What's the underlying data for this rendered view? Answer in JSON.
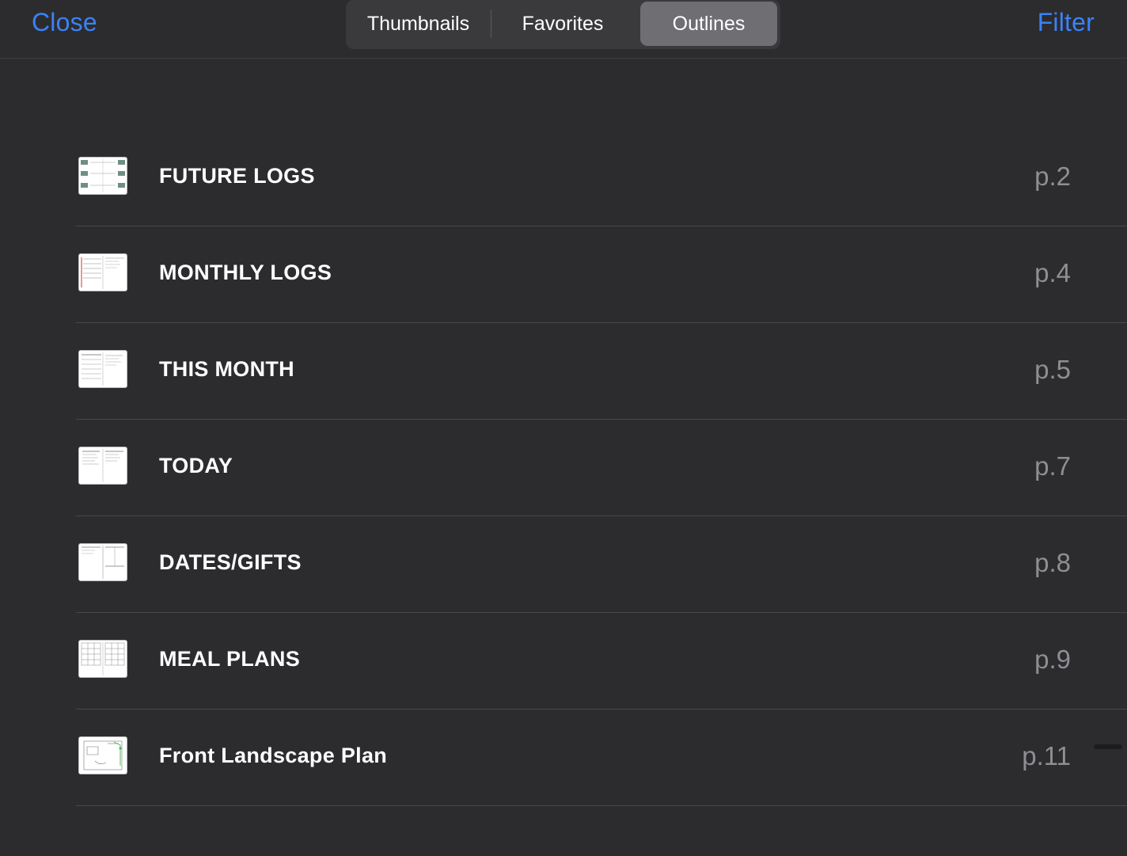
{
  "header": {
    "close_label": "Close",
    "filter_label": "Filter",
    "tabs": [
      {
        "label": "Thumbnails",
        "selected": false
      },
      {
        "label": "Favorites",
        "selected": false
      },
      {
        "label": "Outlines",
        "selected": true
      }
    ]
  },
  "colors": {
    "accent": "#3b82f6",
    "background": "#2c2c2e",
    "selected_tab": "#6e6e73",
    "page_number": "#8e8e93"
  },
  "outlines": [
    {
      "title": "FUTURE LOGS",
      "page": "p.2",
      "thumbnail_icon": "future-logs-thumbnail"
    },
    {
      "title": "MONTHLY LOGS",
      "page": "p.4",
      "thumbnail_icon": "monthly-logs-thumbnail"
    },
    {
      "title": "THIS MONTH",
      "page": "p.5",
      "thumbnail_icon": "this-month-thumbnail"
    },
    {
      "title": "TODAY",
      "page": "p.7",
      "thumbnail_icon": "today-thumbnail"
    },
    {
      "title": "DATES/GIFTS",
      "page": "p.8",
      "thumbnail_icon": "dates-gifts-thumbnail"
    },
    {
      "title": "MEAL PLANS",
      "page": "p.9",
      "thumbnail_icon": "meal-plans-thumbnail"
    },
    {
      "title": "Front Landscape Plan",
      "page": "p.11",
      "thumbnail_icon": "landscape-plan-thumbnail"
    }
  ]
}
